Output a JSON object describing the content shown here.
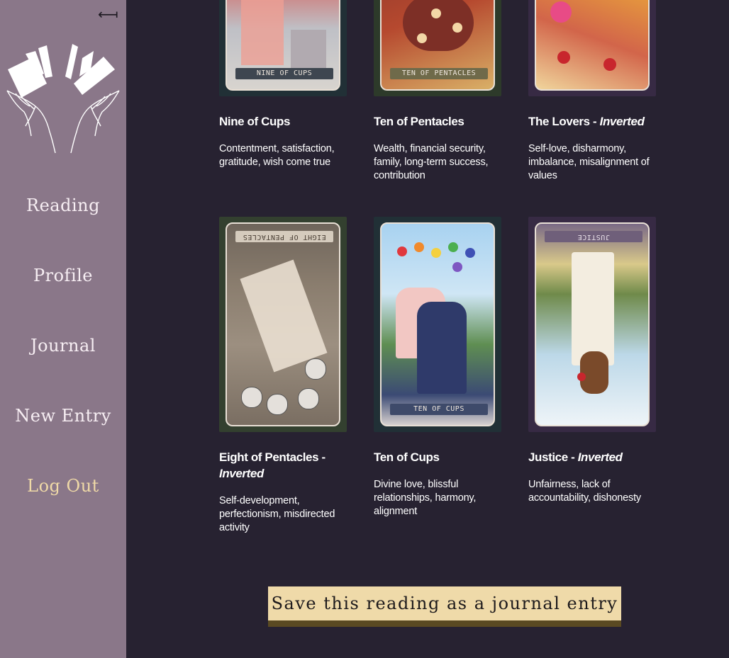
{
  "sidebar": {
    "collapse_glyph": "⟻",
    "nav": [
      "Reading",
      "Profile",
      "Journal",
      "New Entry"
    ],
    "logout": "Log Out"
  },
  "cards": [
    {
      "name": "Nine of Cups",
      "inverted": false,
      "desc": "Contentment, satisfaction, gratitude, wish come true",
      "label": "NINE OF CUPS",
      "frame_color": "#213036"
    },
    {
      "name": "Ten of Pentacles",
      "inverted": false,
      "desc": "Wealth, financial security, family, long-term success, contribution",
      "label": "TEN OF PENTACLES",
      "frame_color": "#2d3a2a"
    },
    {
      "name": "The Lovers",
      "inverted": true,
      "desc": "Self-love, disharmony, imbalance, misalignment of values",
      "label": "",
      "frame_color": "#372a44"
    },
    {
      "name": "Eight of Pentacles",
      "inverted": true,
      "desc": "Self-development, perfectionism, misdirected activity",
      "label": "EIGHT OF PENTACLES",
      "frame_color": "#33402f"
    },
    {
      "name": "Ten of Cups",
      "inverted": false,
      "desc": "Divine love, blissful relationships, harmony, alignment",
      "label": "TEN OF CUPS",
      "frame_color": "#213036"
    },
    {
      "name": "Justice",
      "inverted": true,
      "desc": "Unfairness, lack of accountability, dishonesty",
      "label": "JUSTICE",
      "frame_color": "#372a44"
    }
  ],
  "inverted_word": "Inverted",
  "title_separator": " - ",
  "save_button": "Save this reading as a journal entry"
}
